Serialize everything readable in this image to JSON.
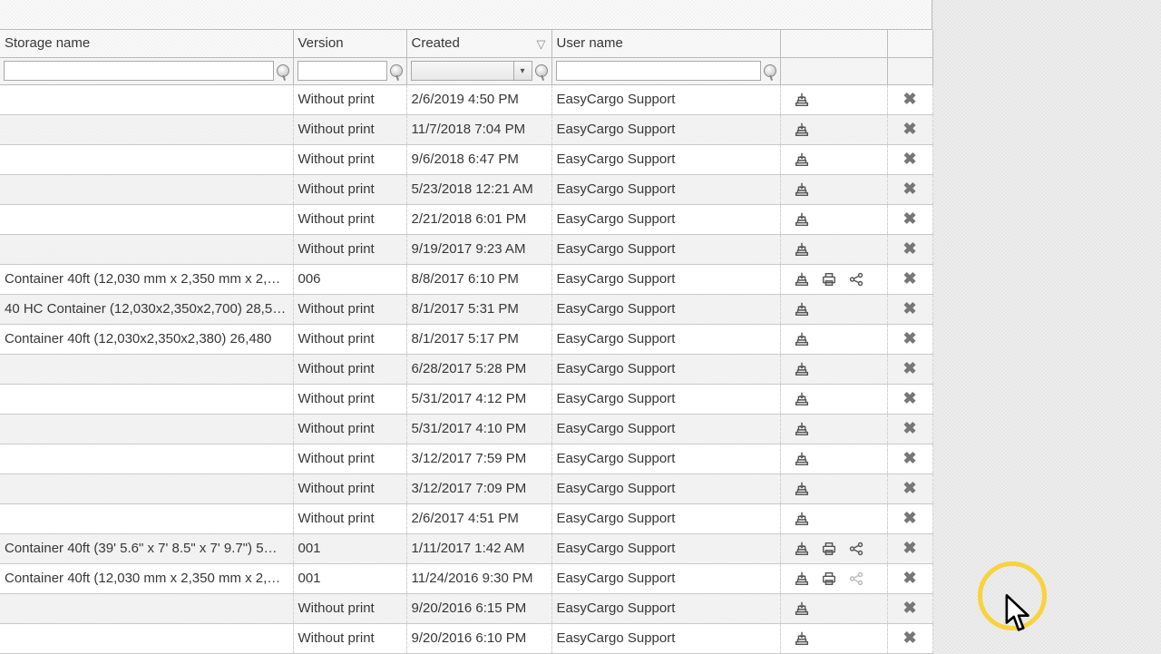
{
  "columns": {
    "storage": "Storage name",
    "version": "Version",
    "created": "Created",
    "user": "User name"
  },
  "filters": {
    "storage": "",
    "version": "",
    "created": "",
    "user": ""
  },
  "rows": [
    {
      "storage": "",
      "version": "Without print",
      "created": "2/6/2019 4:50 PM",
      "user": "EasyCargo Support",
      "print": false,
      "share": false
    },
    {
      "storage": "",
      "version": "Without print",
      "created": "11/7/2018 7:04 PM",
      "user": "EasyCargo Support",
      "print": false,
      "share": false
    },
    {
      "storage": "",
      "version": "Without print",
      "created": "9/6/2018 6:47 PM",
      "user": "EasyCargo Support",
      "print": false,
      "share": false
    },
    {
      "storage": "",
      "version": "Without print",
      "created": "5/23/2018 12:21 AM",
      "user": "EasyCargo Support",
      "print": false,
      "share": false
    },
    {
      "storage": "",
      "version": "Without print",
      "created": "2/21/2018 6:01 PM",
      "user": "EasyCargo Support",
      "print": false,
      "share": false
    },
    {
      "storage": "",
      "version": "Without print",
      "created": "9/19/2017 9:23 AM",
      "user": "EasyCargo Support",
      "print": false,
      "share": false
    },
    {
      "storage": "Container 40ft (12,030 mm x 2,350 mm x 2,…",
      "version": "006",
      "created": "8/8/2017 6:10 PM",
      "user": "EasyCargo Support",
      "print": true,
      "share": true
    },
    {
      "storage": "40 HC Container (12,030x2,350x2,700) 28,5…",
      "version": "Without print",
      "created": "8/1/2017 5:31 PM",
      "user": "EasyCargo Support",
      "print": false,
      "share": false
    },
    {
      "storage": "Container 40ft (12,030x2,350x2,380) 26,480",
      "version": "Without print",
      "created": "8/1/2017 5:17 PM",
      "user": "EasyCargo Support",
      "print": false,
      "share": false
    },
    {
      "storage": "",
      "version": "Without print",
      "created": "6/28/2017 5:28 PM",
      "user": "EasyCargo Support",
      "print": false,
      "share": false
    },
    {
      "storage": "",
      "version": "Without print",
      "created": "5/31/2017 4:12 PM",
      "user": "EasyCargo Support",
      "print": false,
      "share": false
    },
    {
      "storage": "",
      "version": "Without print",
      "created": "5/31/2017 4:10 PM",
      "user": "EasyCargo Support",
      "print": false,
      "share": false
    },
    {
      "storage": "",
      "version": "Without print",
      "created": "3/12/2017 7:59 PM",
      "user": "EasyCargo Support",
      "print": false,
      "share": false
    },
    {
      "storage": "",
      "version": "Without print",
      "created": "3/12/2017 7:09 PM",
      "user": "EasyCargo Support",
      "print": false,
      "share": false
    },
    {
      "storage": "",
      "version": "Without print",
      "created": "2/6/2017 4:51 PM",
      "user": "EasyCargo Support",
      "print": false,
      "share": false
    },
    {
      "storage": "Container 40ft (39' 5.6\" x 7' 8.5\" x 7' 9.7\") 5…",
      "version": "001",
      "created": "1/11/2017 1:42 AM",
      "user": "EasyCargo Support",
      "print": true,
      "share": true
    },
    {
      "storage": "Container 40ft (12,030 mm x 2,350 mm x 2,…",
      "version": "001",
      "created": "11/24/2016 9:30 PM",
      "user": "EasyCargo Support",
      "print": true,
      "share": true,
      "share_disabled": true
    },
    {
      "storage": "",
      "version": "Without print",
      "created": "9/20/2016 6:15 PM",
      "user": "EasyCargo Support",
      "print": false,
      "share": false
    },
    {
      "storage": "",
      "version": "Without print",
      "created": "9/20/2016 6:10 PM",
      "user": "EasyCargo Support",
      "print": false,
      "share": false
    }
  ]
}
